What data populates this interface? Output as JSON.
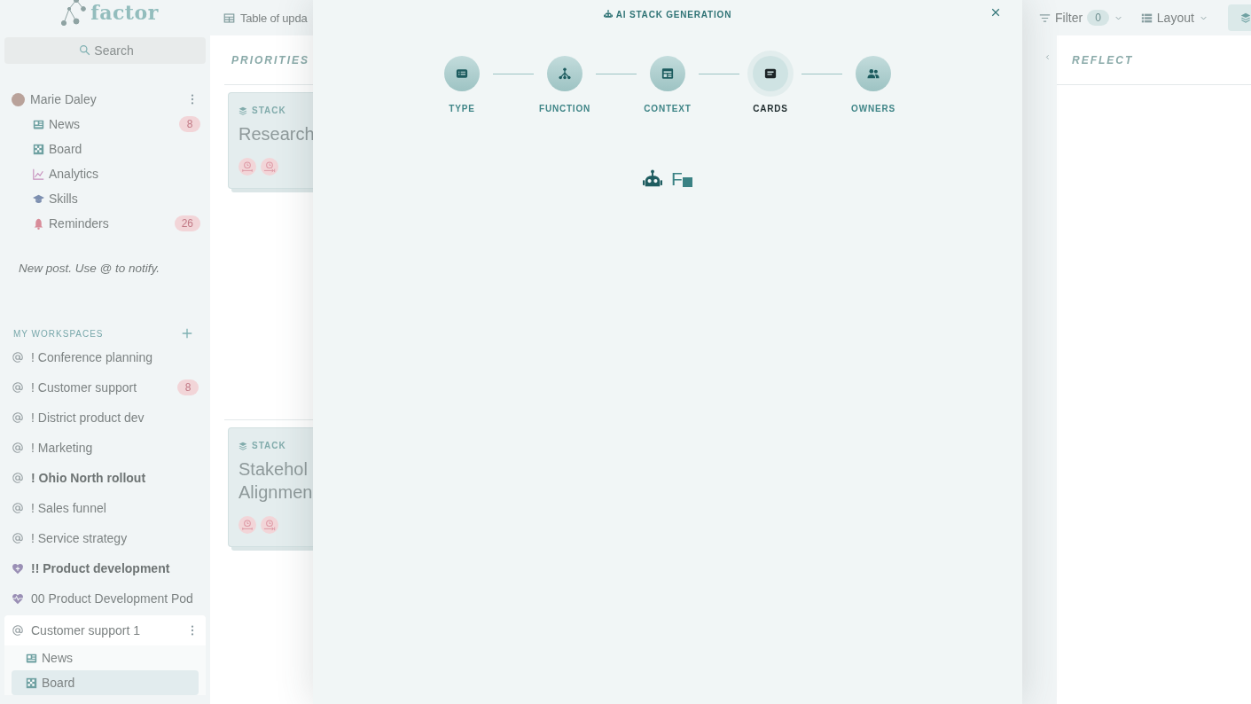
{
  "sidebar": {
    "brand": "factor",
    "search": {
      "placeholder": "Search"
    },
    "user": {
      "name": "Marie Daley",
      "items": [
        {
          "label": "News",
          "kind": "news",
          "badge": "8",
          "selected": false
        },
        {
          "label": "Board",
          "kind": "board",
          "selected": false
        },
        {
          "label": "Analytics",
          "kind": "analytics",
          "selected": false
        },
        {
          "label": "Skills",
          "kind": "skills",
          "selected": false
        },
        {
          "label": "Reminders",
          "kind": "bell",
          "badge": "26",
          "selected": false
        }
      ]
    },
    "composer": {
      "placeholder": "New post. Use @ to notify."
    },
    "workspaces": {
      "heading": "MY WORKSPACES",
      "items": [
        {
          "label": "! Conference planning",
          "kind": "at",
          "bold": false,
          "expanded": false
        },
        {
          "label": "! Customer support",
          "kind": "at",
          "bold": false,
          "badge": "8",
          "expanded": false
        },
        {
          "label": "! District product dev",
          "kind": "at",
          "bold": false,
          "expanded": false
        },
        {
          "label": "! Marketing",
          "kind": "at",
          "bold": false,
          "expanded": false
        },
        {
          "label": "! Ohio North rollout",
          "kind": "at",
          "bold": true,
          "expanded": false
        },
        {
          "label": "! Sales funnel",
          "kind": "at",
          "bold": false,
          "expanded": false
        },
        {
          "label": "! Service strategy",
          "kind": "at",
          "bold": false,
          "expanded": false
        },
        {
          "label": "!! Product development",
          "kind": "heart",
          "bold": true,
          "expanded": false
        },
        {
          "label": "00 Product Development Pod",
          "kind": "heart-pulse",
          "bold": false,
          "expanded": false
        },
        {
          "label": "Customer support 1",
          "kind": "at",
          "bold": false,
          "expanded": true,
          "children": [
            {
              "label": "News",
              "kind": "news",
              "selected": false
            },
            {
              "label": "Board",
              "kind": "board",
              "selected": true
            }
          ]
        }
      ]
    }
  },
  "board": {
    "title": "Table of upda",
    "priorities": {
      "heading": "PRIORITIES",
      "lanes": [
        {
          "cards": [
            {
              "tag": "STACK",
              "title_lines": [
                "Research"
              ]
            }
          ]
        },
        {
          "cards": [
            {
              "tag": "STACK",
              "title_lines": [
                "Stakehol",
                "Alignmen"
              ]
            }
          ]
        }
      ]
    },
    "toolbar": {
      "filter": {
        "label": "Filter",
        "count": "0"
      },
      "layout": {
        "label": "Layout"
      }
    },
    "reflect": {
      "heading": "REFLECT"
    }
  },
  "modal": {
    "title": "AI STACK GENERATION",
    "steps": [
      {
        "label": "TYPE",
        "kind": "list-card",
        "selected": false
      },
      {
        "label": "FUNCTION",
        "kind": "hierarchy",
        "selected": false
      },
      {
        "label": "CONTEXT",
        "kind": "table-card",
        "selected": false
      },
      {
        "label": "CARDS",
        "kind": "message-card",
        "selected": true
      },
      {
        "label": "OWNERS",
        "kind": "people",
        "selected": false
      }
    ],
    "typing": "F"
  }
}
